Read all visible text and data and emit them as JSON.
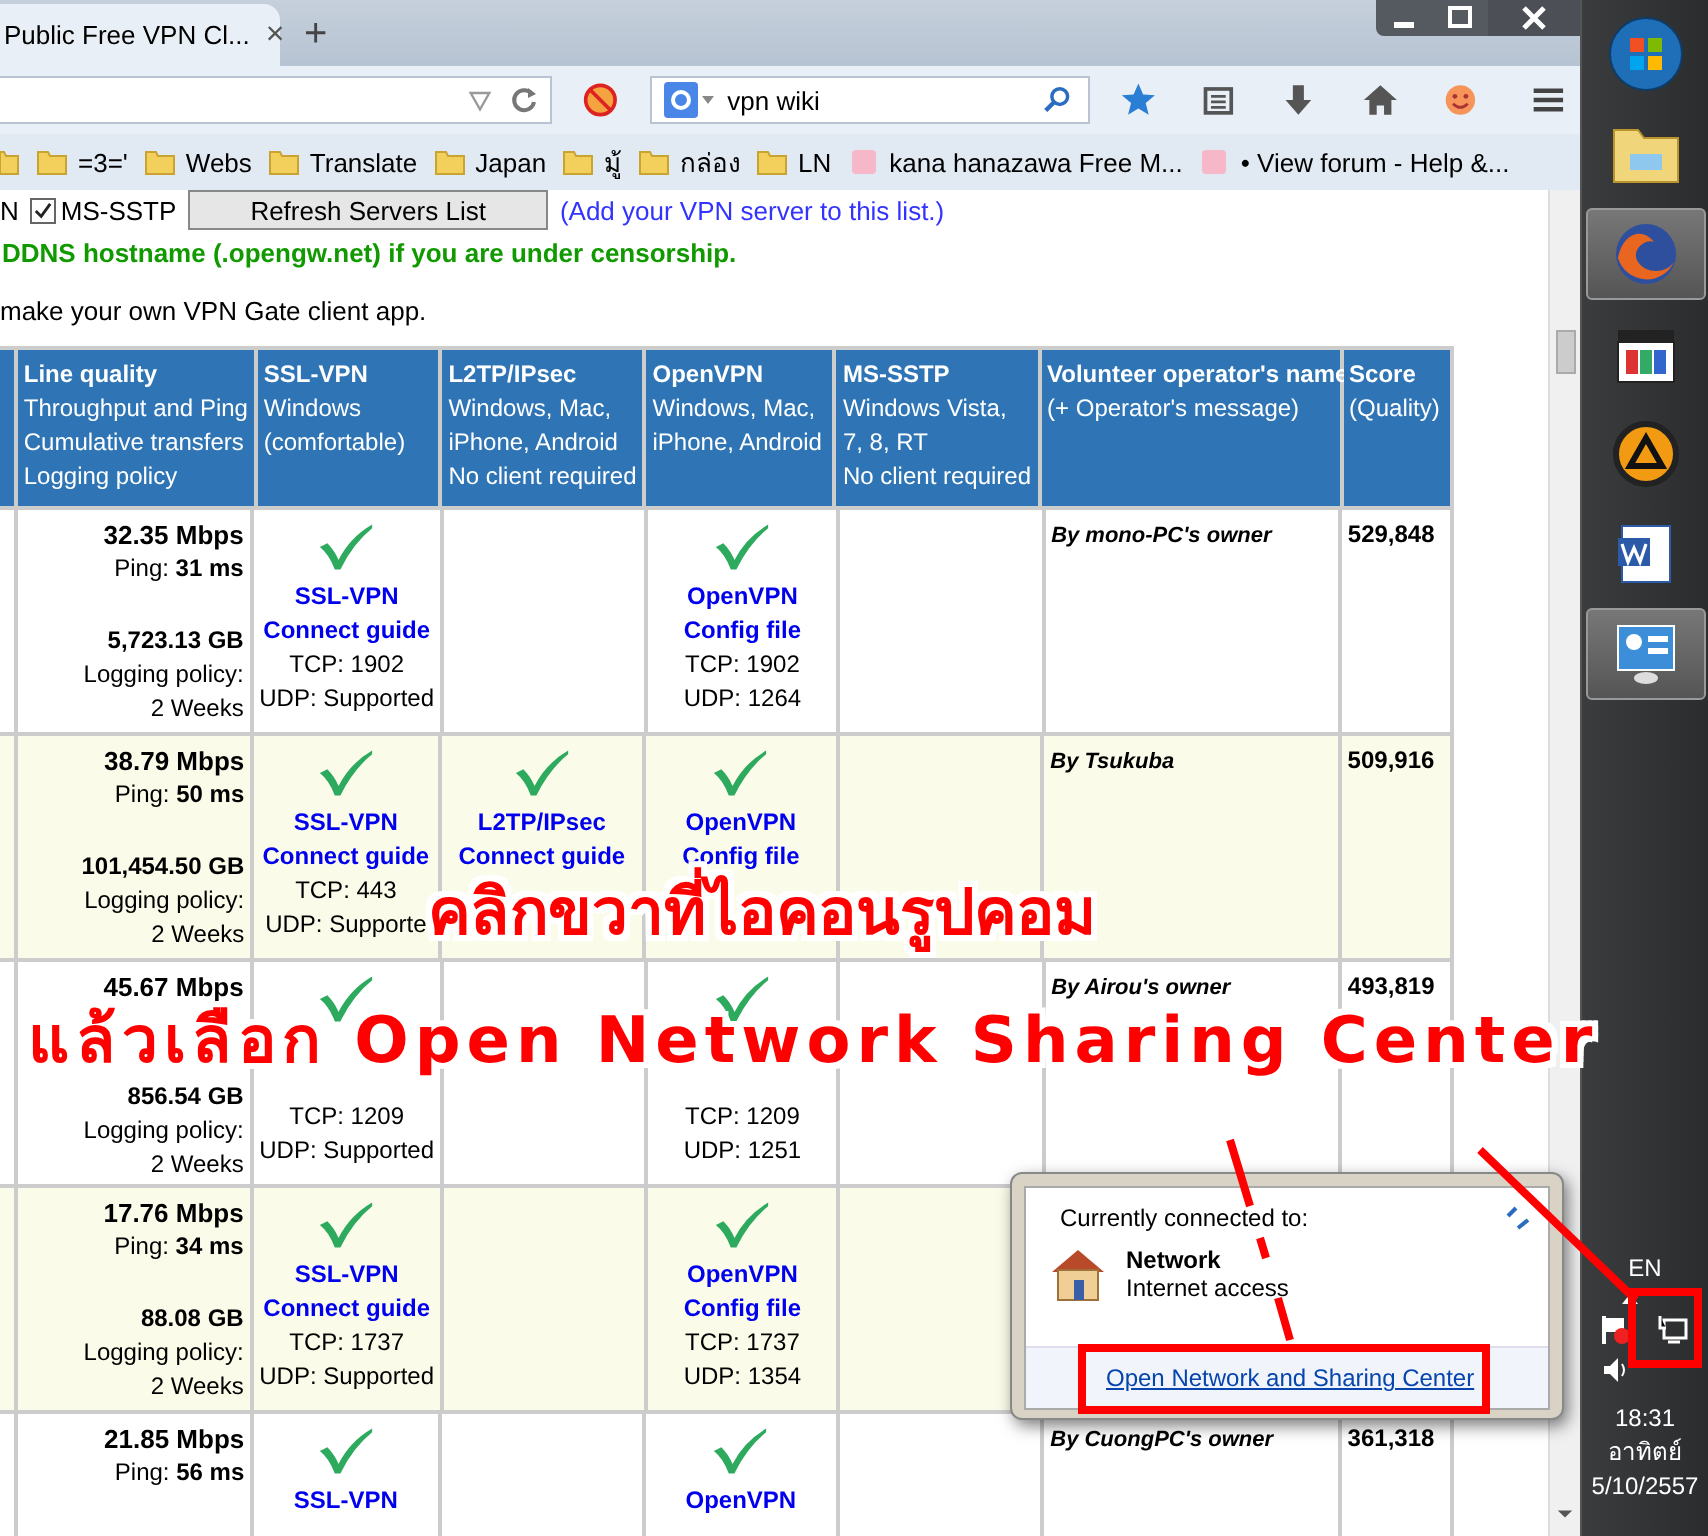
{
  "browser": {
    "tab": {
      "title": "Public Free VPN Cl...",
      "close": "×",
      "selected": true
    },
    "new_tab": "+",
    "search": {
      "value": "vpn wiki"
    },
    "bookmarks": [
      {
        "kind": "folder"
      },
      {
        "kind": "folder",
        "label": "=3='"
      },
      {
        "kind": "folder",
        "label": "Webs"
      },
      {
        "kind": "folder",
        "label": "Translate"
      },
      {
        "kind": "folder",
        "label": "Japan"
      },
      {
        "kind": "folder",
        "label": "มู้"
      },
      {
        "kind": "folder",
        "label": "กล่อง"
      },
      {
        "kind": "folder",
        "label": "LN"
      },
      {
        "kind": "page",
        "label": "kana hanazawa Free M..."
      },
      {
        "kind": "page",
        "label": "• View forum - Help &..."
      }
    ]
  },
  "page": {
    "top_line": {
      "fragment": "N",
      "checkbox": {
        "label": "MS-SSTP",
        "checked": true
      },
      "button": "Refresh Servers List",
      "link": "(Add your VPN server to this list.)"
    },
    "notice": "DDNS hostname (.opengw.net) if you are under censorship.",
    "intro": "make your own VPN Gate client app.",
    "table": {
      "columns": [
        {
          "title": "Line quality",
          "lines": [
            "Throughput and Ping",
            "Cumulative transfers",
            "Logging policy"
          ]
        },
        {
          "title": "SSL-VPN",
          "lines": [
            "Windows",
            "(comfortable)"
          ]
        },
        {
          "title": "L2TP/IPsec",
          "lines": [
            "Windows, Mac,",
            "iPhone, Android",
            "No client required"
          ]
        },
        {
          "title": "OpenVPN",
          "lines": [
            "Windows, Mac,",
            "iPhone, Android"
          ]
        },
        {
          "title": "MS-SSTP",
          "lines": [
            "Windows Vista,",
            "7, 8, RT",
            "No client required"
          ]
        },
        {
          "title": "Volunteer operator's name",
          "lines": [
            "(+ Operator's message)"
          ]
        },
        {
          "title": "Score",
          "lines": [
            "(Quality)"
          ]
        }
      ],
      "rows": [
        {
          "highlighted": false,
          "cells": [
            {
              "kind": "quality",
              "speed": "32.35 Mbps",
              "ping": "Ping: **31 ms**",
              "transfer": "5,723.13 GB",
              "logging": "Logging policy:",
              "period": "2 Weeks"
            },
            {
              "kind": "protocol",
              "links": [
                "SSL-VPN",
                "Connect guide"
              ],
              "lines": [
                "TCP: 1902",
                "UDP: Supported"
              ]
            },
            {
              "kind": "empty"
            },
            {
              "kind": "protocol",
              "links": [
                "OpenVPN",
                "Config file"
              ],
              "lines": [
                "TCP: 1902",
                "UDP: 1264"
              ]
            },
            {
              "kind": "empty"
            },
            {
              "kind": "operator",
              "text": "By mono-PC's owner"
            },
            {
              "kind": "score",
              "text": "529,848"
            }
          ]
        },
        {
          "highlighted": true,
          "cells": [
            {
              "kind": "quality",
              "speed": "38.79 Mbps",
              "ping": "Ping: **50 ms**",
              "transfer": "101,454.50 GB",
              "logging": "Logging policy:",
              "period": "2 Weeks"
            },
            {
              "kind": "protocol",
              "links": [
                "SSL-VPN",
                "Connect guide"
              ],
              "lines": [
                "TCP: 443",
                "UDP: Supporte"
              ]
            },
            {
              "kind": "protocol",
              "links": [
                "L2TP/IPsec",
                "Connect guide"
              ]
            },
            {
              "kind": "protocol",
              "links": [
                "OpenVPN",
                "Config file"
              ]
            },
            {
              "kind": "empty"
            },
            {
              "kind": "operator",
              "text": "By Tsukuba"
            },
            {
              "kind": "score",
              "text": "509,916"
            }
          ]
        },
        {
          "highlighted": false,
          "cells": [
            {
              "kind": "quality",
              "speed": "45.67 Mbps",
              "transfer": "856.54 GB",
              "logging": "Logging policy:",
              "period": "2 Weeks"
            },
            {
              "kind": "protocol",
              "lines": [
                "TCP: 1209",
                "UDP: Supported"
              ]
            },
            {
              "kind": "empty"
            },
            {
              "kind": "protocol",
              "lines": [
                "TCP: 1209",
                "UDP: 1251"
              ]
            },
            {
              "kind": "empty"
            },
            {
              "kind": "operator",
              "text": "By Airou's owner"
            },
            {
              "kind": "score",
              "text": "493,819"
            }
          ]
        },
        {
          "highlighted": true,
          "cells": [
            {
              "kind": "quality",
              "speed": "17.76 Mbps",
              "ping": "Ping: **34 ms**",
              "transfer": "88.08 GB",
              "logging": "Logging policy:",
              "period": "2 Weeks"
            },
            {
              "kind": "protocol",
              "links": [
                "SSL-VPN",
                "Connect guide"
              ],
              "lines": [
                "TCP: 1737",
                "UDP: Supported"
              ]
            },
            {
              "kind": "empty"
            },
            {
              "kind": "protocol",
              "links": [
                "OpenVPN",
                "Config file"
              ],
              "lines": [
                "TCP: 1737",
                "UDP: 1354"
              ]
            },
            {
              "kind": "empty"
            },
            {
              "kind": "operator"
            },
            {
              "kind": "score"
            }
          ]
        },
        {
          "highlighted": false,
          "cells": [
            {
              "kind": "quality",
              "speed": "21.85 Mbps",
              "ping": "Ping: **56 ms**"
            },
            {
              "kind": "protocol",
              "links": [
                "SSL-VPN"
              ]
            },
            {
              "kind": "empty"
            },
            {
              "kind": "protocol",
              "links": [
                "OpenVPN"
              ]
            },
            {
              "kind": "empty"
            },
            {
              "kind": "operator",
              "text": "By CuongPC's owner"
            },
            {
              "kind": "score",
              "text": "361,318"
            }
          ]
        }
      ]
    }
  },
  "annotation": {
    "lines": [
      "คลิกขวาที่ไอคอนรูปคอม",
      "แล้วเลือก Open Network Sharing Center"
    ]
  },
  "network_popup": {
    "heading": "Currently connected to:",
    "network": "Network",
    "status": "Internet access",
    "link": "Open Network and Sharing Center"
  },
  "taskbar": {
    "apps": [
      {
        "kind": "start",
        "active": false
      },
      {
        "kind": "explorer",
        "active": false
      },
      {
        "kind": "firefox",
        "active": true
      },
      {
        "kind": "media",
        "active": false
      },
      {
        "kind": "aimp",
        "active": false
      },
      {
        "kind": "word",
        "active": false
      },
      {
        "kind": "control",
        "active": true
      }
    ],
    "language": "EN",
    "time": "18:31",
    "day": "อาทิตย์",
    "date": "5/10/2557"
  }
}
